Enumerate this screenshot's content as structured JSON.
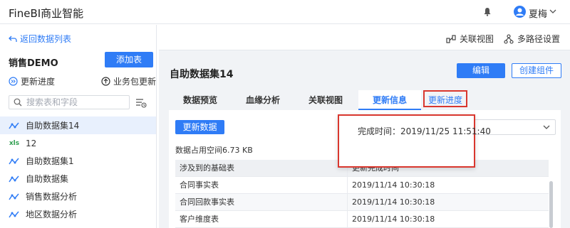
{
  "app": {
    "title": "FineBI商业智能"
  },
  "user": {
    "name": "夏梅"
  },
  "sidebar": {
    "back_label": "返回数据列表",
    "project_title": "销售DEMO",
    "add_table_label": "添加表",
    "update_progress_label": "更新进度",
    "package_update_label": "业务包更新",
    "search_placeholder": "搜索表和字段",
    "items": [
      {
        "label": "自助数据集14",
        "icon": "self-service-dataset-icon",
        "active": true
      },
      {
        "label": "12",
        "icon": "excel-icon",
        "active": false
      },
      {
        "label": "自助数据集1",
        "icon": "self-service-dataset-icon",
        "active": false
      },
      {
        "label": "自助数据集",
        "icon": "self-service-dataset-icon",
        "active": false
      },
      {
        "label": "销售数据分析",
        "icon": "self-service-dataset-icon",
        "active": false
      },
      {
        "label": "地区数据分析",
        "icon": "self-service-dataset-icon",
        "active": false
      }
    ]
  },
  "toolbar": {
    "relation_view_label": "关联视图",
    "multipath_label": "多路径设置"
  },
  "dataset": {
    "title": "自助数据集14",
    "edit_label": "编辑",
    "create_component_label": "创建组件"
  },
  "tabs": [
    {
      "label": "数据预览"
    },
    {
      "label": "血缘分析"
    },
    {
      "label": "关联视图"
    },
    {
      "label": "更新信息"
    }
  ],
  "tab_progress_label": "更新进度",
  "panel": {
    "refresh_label": "更新数据",
    "space_label": "数据占用空间6.73 KB",
    "table": {
      "headers": [
        "涉及到的基础表",
        "更新完成时间"
      ],
      "rows": [
        [
          "合同事实表",
          "2019/11/14 10:30:18"
        ],
        [
          "合同回款事实表",
          "2019/11/14 10:30:18"
        ],
        [
          "客户维度表",
          "2019/11/14 10:30:18"
        ]
      ]
    }
  },
  "popup": {
    "text": "完成时间：2019/11/25 11:51:40"
  },
  "colors": {
    "accent": "#2f7cf6",
    "highlight": "#d9372e"
  }
}
